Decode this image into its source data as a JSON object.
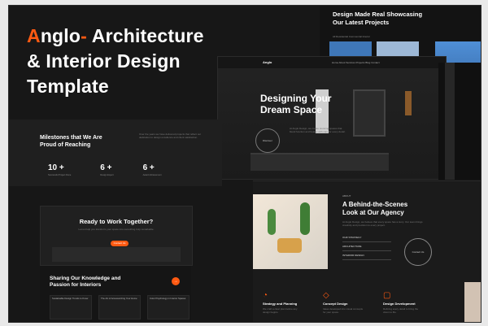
{
  "title": {
    "logo_a": "A",
    "logo_rest": "nglo",
    "logo_dash": "-",
    "line1_rest": "Architecture",
    "line2": "& Interior Design",
    "line3": "Template"
  },
  "top_right": {
    "heading_line1": "Design Made Real Showcasing",
    "heading_line2": "Our Latest Projects",
    "tabs_text": "All   Residential   Commercial   Interior"
  },
  "hero": {
    "nav_logo": "Anglo",
    "nav_links": "Home   About   Services   Projects   Blog   Contact",
    "heading_line1": "Designing Your",
    "heading_line2": "Dream Space",
    "button_label": "Discover",
    "paragraph": "At Anglo Design, we create stunning spaces that blend function and beauty with care for every detail."
  },
  "milestones": {
    "heading_line1": "Milestones that We Are",
    "heading_line2": "Proud of Reaching",
    "paragraph": "Over the years we have delivered projects that reflect our dedication to design excellence and client satisfaction.",
    "stats": [
      {
        "value": "10 +",
        "label": "Successful Project Done"
      },
      {
        "value": "6 +",
        "label": "Design Expert"
      },
      {
        "value": "6 +",
        "label": "Award Achievement"
      }
    ]
  },
  "agency": {
    "eyebrow": "ABOUT",
    "heading_line1": "A Behind-the-Scenes",
    "heading_line2": "Look at Our Agency",
    "paragraph": "At Anglo Design, we believe that every space has a story. Our team brings creativity and precision to every project.",
    "rows": [
      "OUR STRATEGY",
      "ARCHITECTURE",
      "INTERIOR DESIGN"
    ],
    "circle_label": "Contact Us",
    "services": [
      {
        "title": "Strategy and Planning",
        "desc": "We craft a clear plan before any design begins."
      },
      {
        "title": "Concept Design",
        "desc": "Ideas developed into visual concepts for your space."
      },
      {
        "title": "Design Development",
        "desc": "Refining every detail to bring the vision to life."
      }
    ]
  },
  "ready": {
    "heading": "Ready to Work Together?",
    "paragraph": "Let us help you transform your space into something truly remarkable.",
    "button_label": "Contact Us"
  },
  "blog": {
    "heading_line1": "Sharing Our Knowledge and",
    "heading_line2": "Passion for Interiors",
    "more_icon": "arrow-right-icon",
    "cards": [
      "Sustainable Design Trends to Know",
      "The Art of Accessorizing Your Home",
      "Color Psychology in Interior Spaces"
    ]
  },
  "colors": {
    "accent": "#ff5a12",
    "background": "#171717"
  }
}
